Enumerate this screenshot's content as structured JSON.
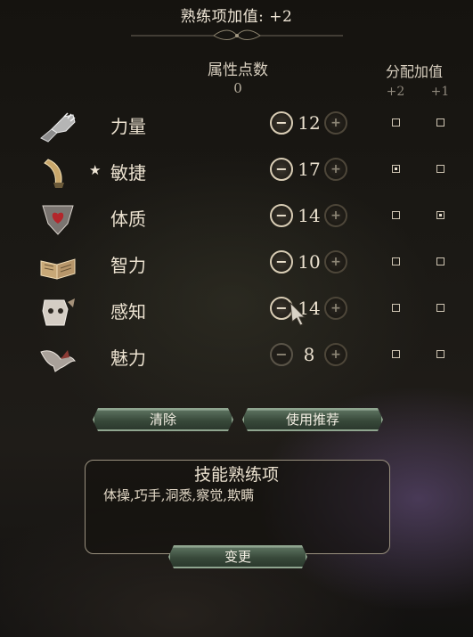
{
  "header": {
    "title": "熟练项加值: +2"
  },
  "points": {
    "label": "属性点数",
    "remaining": "0"
  },
  "bonus": {
    "label": "分配加值",
    "col2": "+2",
    "col1": "+1"
  },
  "attributes": [
    {
      "name": "力量",
      "value": "12",
      "icon": "gauntlet-icon",
      "starred": false,
      "plus2": false,
      "plus1": false
    },
    {
      "name": "敏捷",
      "value": "17",
      "icon": "horn-icon",
      "starred": true,
      "plus2": true,
      "plus1": false
    },
    {
      "name": "体质",
      "value": "14",
      "icon": "heart-shield-icon",
      "starred": false,
      "plus2": false,
      "plus1": true
    },
    {
      "name": "智力",
      "value": "10",
      "icon": "open-book-icon",
      "starred": false,
      "plus2": false,
      "plus1": false
    },
    {
      "name": "感知",
      "value": "14",
      "icon": "owlbear-mask-icon",
      "starred": false,
      "plus2": false,
      "plus1": false
    },
    {
      "name": "魅力",
      "value": "8",
      "icon": "bird-icon",
      "starred": false,
      "plus2": false,
      "plus1": false
    }
  ],
  "star_symbol": "★",
  "buttons": {
    "clear": "清除",
    "recommend": "使用推荐",
    "change": "变更"
  },
  "skills": {
    "title": "技能熟练项",
    "list": "体操,巧手,洞悉,察觉,欺瞒"
  },
  "colors": {
    "button_green": "#4a5e4c",
    "text": "#ece2d0",
    "panel_border": "#9a917f"
  }
}
